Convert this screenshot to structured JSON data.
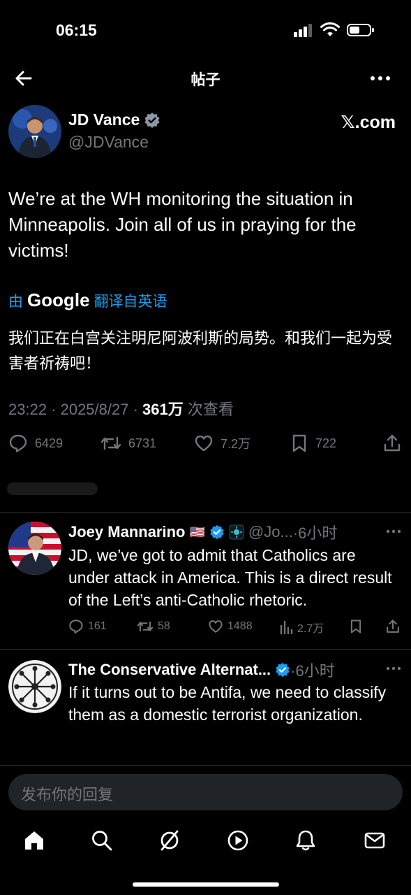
{
  "status": {
    "time": "06:15"
  },
  "header": {
    "title": "帖子"
  },
  "tweet": {
    "author_name": "JD Vance",
    "author_handle": "@JDVance",
    "source_badge": "𝕏.com",
    "text": "We’re at the WH monitoring the situation in Minneapolis. Join all of us in praying for the victims!",
    "translate_prefix": "由",
    "translate_brand": "Google",
    "translate_suffix": "翻译自英语",
    "translated_text": "我们正在白宫关注明尼阿波利斯的局势。和我们一起为受害者祈祷吧！",
    "time": "23:22 · 2025/8/27 · ",
    "views_count": "361万",
    "views_label": " 次查看",
    "stats": {
      "replies": "6429",
      "reposts": "6731",
      "likes": "7.2万",
      "bookmarks": "722"
    }
  },
  "replies": [
    {
      "name": "Joey Mannarino",
      "flag": "🇺🇸",
      "handle": "@Jo...",
      "time": "·6小时",
      "text": "JD, we’ve got to admit that Catholics are under attack in America. This is a direct result of the Left’s anti-Catholic rhetoric.",
      "stats": {
        "replies": "161",
        "reposts": "58",
        "likes": "1488",
        "views": "2.7万"
      }
    },
    {
      "name": "The Conservative Alternat...",
      "time": "·6小时",
      "text": "If it turns out to be Antifa, we need to classify them as a domestic terrorist organization."
    }
  ],
  "composer": {
    "placeholder": "发布你的回复"
  },
  "colors": {
    "accent": "#1d9bf0",
    "muted": "#71767b",
    "background": "#000000",
    "gold": "#e2b719"
  },
  "tabs": [
    "home-icon",
    "search-icon",
    "grok-icon",
    "video-icon",
    "notifications-icon",
    "messages-icon"
  ]
}
